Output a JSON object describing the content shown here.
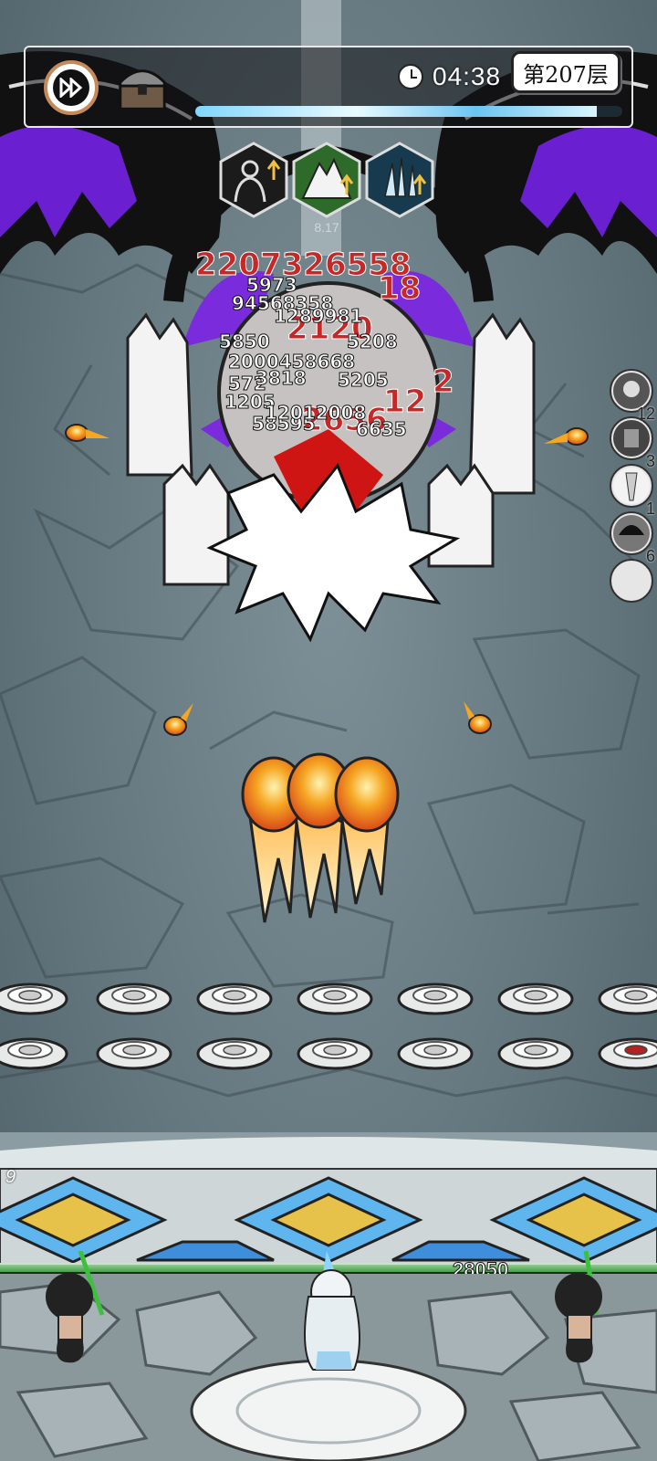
{
  "hud": {
    "fast_forward_icon": "fast-forward-icon",
    "chest_icon": "treasure-chest-icon",
    "clock_icon": "clock-icon",
    "timer": "04:38",
    "floor": "第207层",
    "boss_hp_fraction": 0.94
  },
  "buffs": [
    {
      "icon": "character-upgrade-icon",
      "label": ""
    },
    {
      "icon": "mountain-upgrade-icon",
      "label": "8.17"
    },
    {
      "icon": "triple-spike-upgrade-icon",
      "label": ""
    }
  ],
  "abilities": [
    {
      "icon": "skull-icon",
      "count": "12"
    },
    {
      "icon": "warrior-icon",
      "count": "3"
    },
    {
      "icon": "drill-icon",
      "count": "1"
    },
    {
      "icon": "hair-icon",
      "count": "6"
    },
    {
      "icon": "empty-slot-icon",
      "count": ""
    }
  ],
  "damage_numbers": {
    "red": [
      "2207326558",
      "18",
      "2",
      "12",
      "2120",
      "2656"
    ],
    "white": [
      "5973",
      "94568358",
      "1289981",
      "5850",
      "5208",
      "2000458668",
      "572",
      "5205",
      "3818",
      "1205",
      "58595",
      "12012008",
      "6635"
    ]
  },
  "wall": {
    "count": "9",
    "hp": "28050",
    "hp_fraction": 1.0
  },
  "colors": {
    "boss_wing": "#6a1fd0",
    "damage_red": "#c62828",
    "hp_green": "#4c9b50",
    "crystal_blue": "#5fb6ef",
    "crystal_gold": "#e6c24a"
  }
}
